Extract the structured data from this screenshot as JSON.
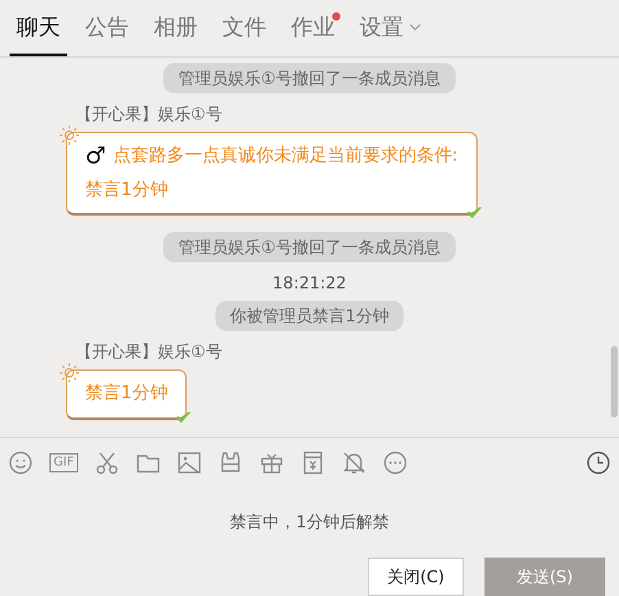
{
  "tabs": [
    {
      "label": "聊天",
      "selected": true,
      "badge": false,
      "dropdown": false
    },
    {
      "label": "公告",
      "selected": false,
      "badge": false,
      "dropdown": false
    },
    {
      "label": "相册",
      "selected": false,
      "badge": false,
      "dropdown": false
    },
    {
      "label": "文件",
      "selected": false,
      "badge": false,
      "dropdown": false
    },
    {
      "label": "作业",
      "selected": false,
      "badge": true,
      "dropdown": false
    },
    {
      "label": "设置",
      "selected": false,
      "badge": false,
      "dropdown": true
    }
  ],
  "messages": [
    {
      "kind": "system",
      "text": "管理员娱乐①号撤回了一条成员消息"
    },
    {
      "kind": "chat",
      "sender": "【开心果】娱乐①号",
      "male_symbol": "♂",
      "lines": [
        "点套路多一点真诚你未满足当前要求的条件:",
        "禁言1分钟"
      ]
    },
    {
      "kind": "system",
      "text": "管理员娱乐①号撤回了一条成员消息"
    },
    {
      "kind": "time",
      "text": "18:21:22"
    },
    {
      "kind": "system",
      "text": "你被管理员禁言1分钟"
    },
    {
      "kind": "chat",
      "sender": "【开心果】娱乐①号",
      "lines": [
        "禁言1分钟"
      ]
    }
  ],
  "toolbar": {
    "gif_label": "GIF"
  },
  "mute_notice": "禁言中，1分钟后解禁",
  "buttons": {
    "close": "关闭(C)",
    "send": "发送(S)"
  }
}
